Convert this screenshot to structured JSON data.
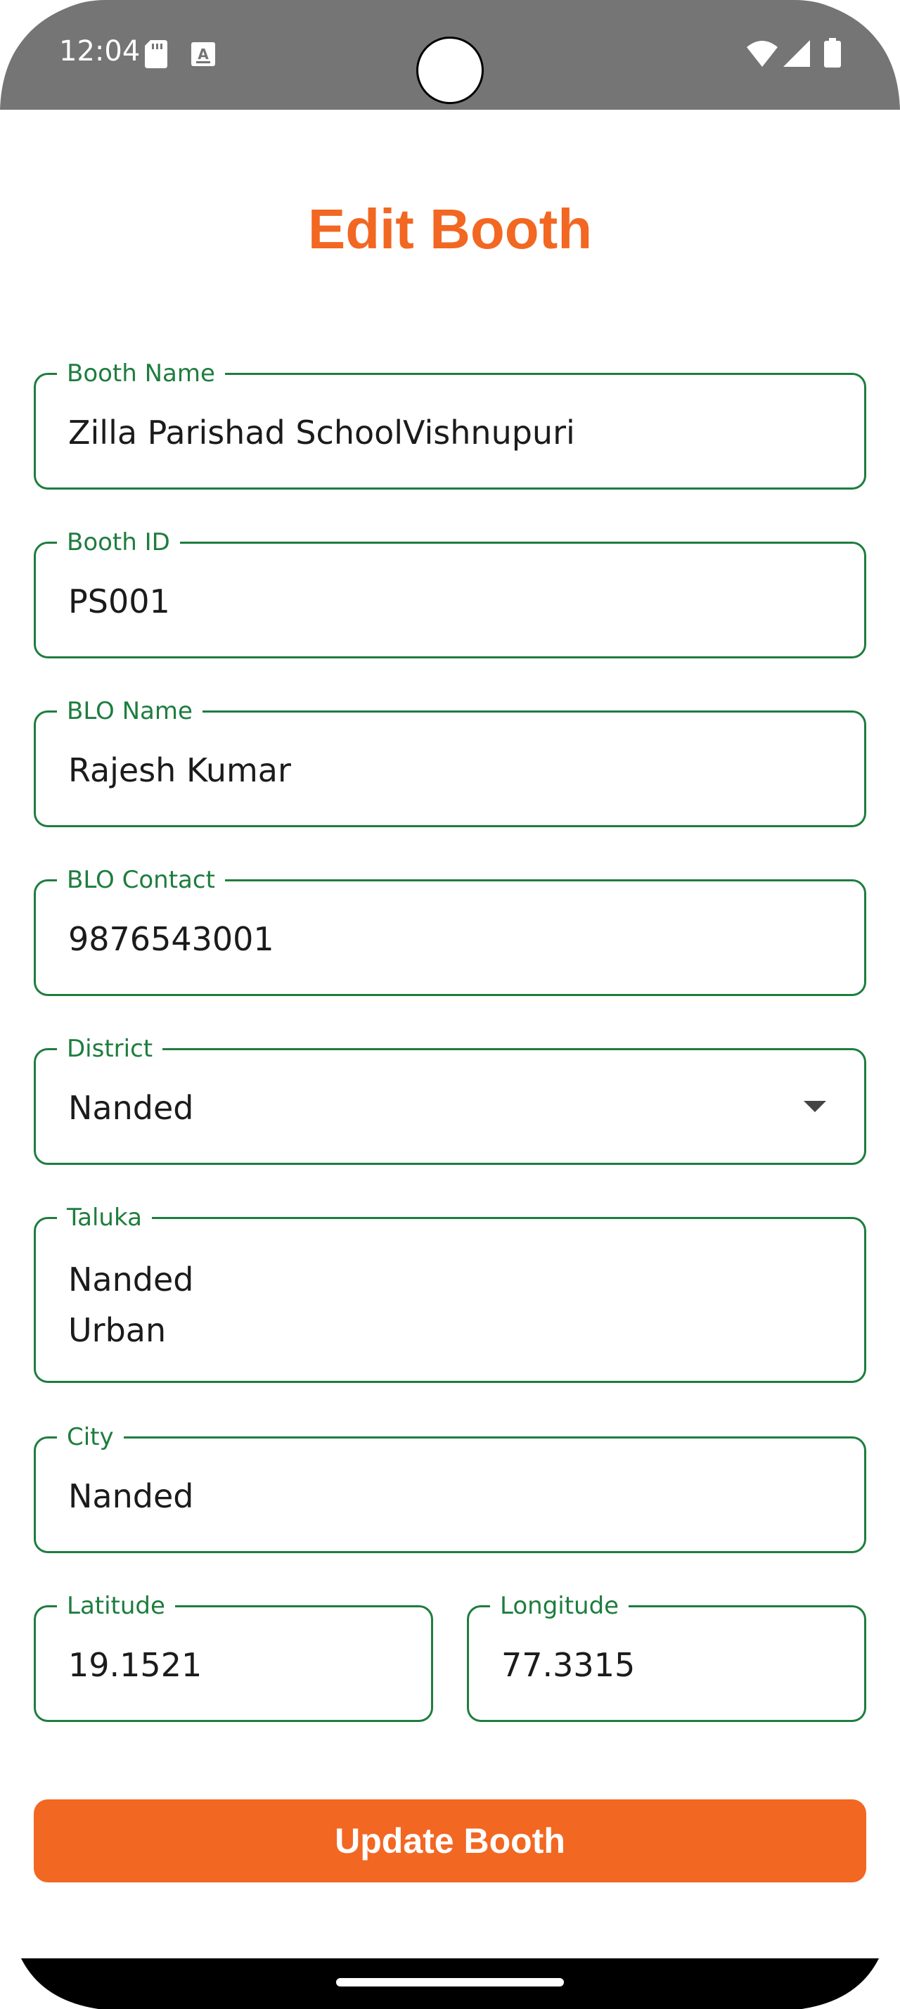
{
  "status_bar": {
    "time": "12:04",
    "icons": [
      "sd-card-icon",
      "a-notification-icon",
      "wifi-icon",
      "signal-icon",
      "battery-icon"
    ]
  },
  "page": {
    "title": "Edit Booth"
  },
  "form": {
    "booth_name": {
      "label": "Booth Name",
      "value": "Zilla Parishad SchoolVishnupuri"
    },
    "booth_id": {
      "label": "Booth ID",
      "value": "PS001"
    },
    "blo_name": {
      "label": "BLO Name",
      "value": "Rajesh Kumar"
    },
    "blo_contact": {
      "label": "BLO Contact",
      "value": "9876543001"
    },
    "district": {
      "label": "District",
      "value": "Nanded"
    },
    "taluka": {
      "label": "Taluka",
      "value": "Nanded\nUrban"
    },
    "city": {
      "label": "City",
      "value": "Nanded"
    },
    "latitude": {
      "label": "Latitude",
      "value": "19.1521"
    },
    "longitude": {
      "label": "Longitude",
      "value": "77.3315"
    }
  },
  "actions": {
    "update_label": "Update Booth"
  },
  "colors": {
    "accent": "#f26722",
    "field_border": "#1e7d3e",
    "status_bar": "#757575"
  }
}
